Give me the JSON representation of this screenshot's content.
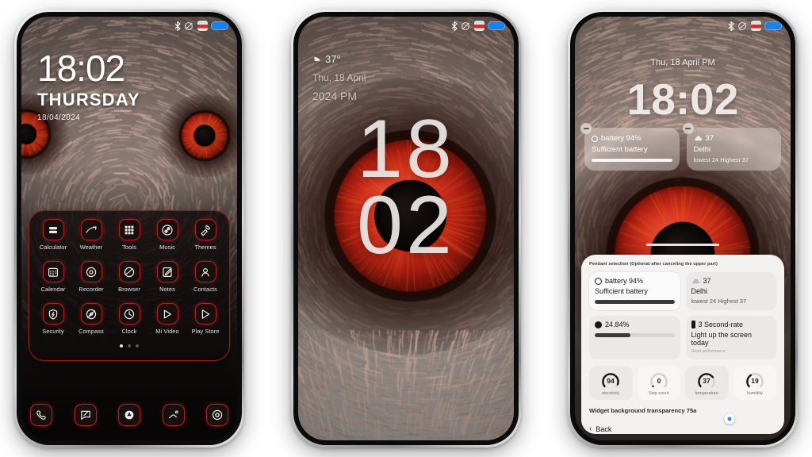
{
  "meta": {
    "scene": "Three Android phone mockups showing a themed lock screen, a minimal clock lock screen, and a widget customization sheet",
    "background_color": "#ffffff",
    "accent_red": "#b22222",
    "accent_blue": "#2f8fe8"
  },
  "status_bar": {
    "icons": [
      "bluetooth-icon",
      "silent-mode-icon",
      "alarm-icon",
      "battery-icon"
    ],
    "battery_color": "#1b80e8"
  },
  "phone1": {
    "name": "themed-home-screen",
    "clock": {
      "time": "18:02",
      "day": "THURSDAY",
      "date": "18/04/2024"
    },
    "apps": [
      {
        "label": "Calculator",
        "icon": "calculator-icon"
      },
      {
        "label": "Weather",
        "icon": "weather-icon"
      },
      {
        "label": "Tools",
        "icon": "tools-icon"
      },
      {
        "label": "Music",
        "icon": "music-icon"
      },
      {
        "label": "Themes",
        "icon": "themes-icon"
      },
      {
        "label": "Calendar",
        "icon": "calendar-icon"
      },
      {
        "label": "Recorder",
        "icon": "recorder-icon"
      },
      {
        "label": "Browser",
        "icon": "browser-icon"
      },
      {
        "label": "Notes",
        "icon": "notes-icon"
      },
      {
        "label": "Contacts",
        "icon": "contacts-icon"
      },
      {
        "label": "Security",
        "icon": "security-icon"
      },
      {
        "label": "Compass",
        "icon": "compass-icon"
      },
      {
        "label": "Clock",
        "icon": "clock-icon"
      },
      {
        "label": "Mi Video",
        "icon": "mi-video-icon"
      },
      {
        "label": "Play Store",
        "icon": "play-store-icon"
      }
    ],
    "page_dots": {
      "count": 3,
      "active_index": 0
    },
    "dock": [
      {
        "icon": "phone-icon"
      },
      {
        "icon": "messages-icon"
      },
      {
        "icon": "camera-icon"
      },
      {
        "icon": "gallery-icon"
      },
      {
        "icon": "settings-icon"
      }
    ]
  },
  "phone2": {
    "name": "minimal-lock-screen",
    "weather": {
      "icon": "cloud-sun-icon",
      "temperature": "37°",
      "date": "Thu, 18 April",
      "ampm": "2024 PM"
    },
    "clock": {
      "line1": "18",
      "line2": "02"
    }
  },
  "phone3": {
    "name": "widget-edit-lock-screen",
    "date": "Thu, 18 April PM",
    "time": "18:02",
    "widgets": [
      {
        "icon": "battery-ring-icon",
        "title": "battery 94%",
        "subtitle": "Sufficient battery",
        "remove_label": "−"
      },
      {
        "icon": "cloud-icon",
        "title": "37",
        "subtitle": "Delhi",
        "detail": "lowest 24 Highest 37",
        "remove_label": "−"
      }
    ],
    "sheet": {
      "title": "Pendant selection (Optional after canceling the upper part)",
      "options": [
        {
          "icon": "battery-ring-icon",
          "line1": "battery 94%",
          "line2": "Sufficient battery",
          "progress": 100,
          "selected": true
        },
        {
          "icon": "cloud-icon",
          "line1": "37",
          "line2": "Delhi",
          "line3": "lowest 24 Highest 37",
          "selected": false
        },
        {
          "icon": "clock-dot-icon",
          "line1": "24.84%",
          "progress": 45,
          "selected": false
        },
        {
          "icon": "battery-bar-icon",
          "line1": "3 Second-rate",
          "line2": "Light up the screen today",
          "line3": "Good performance",
          "selected": false
        }
      ],
      "gauges": [
        {
          "value": "94",
          "label": "electricity",
          "percent": 94
        },
        {
          "value": "0",
          "label": "Step count",
          "percent": 0
        },
        {
          "value": "37",
          "label": "temperature",
          "percent": 72
        },
        {
          "value": "19",
          "label": "humidity",
          "percent": 38
        }
      ],
      "slider": {
        "label": "Widget background transparency 75a",
        "value": 75
      },
      "back": {
        "label": "Back",
        "icon": "chevron-left-icon"
      }
    }
  }
}
